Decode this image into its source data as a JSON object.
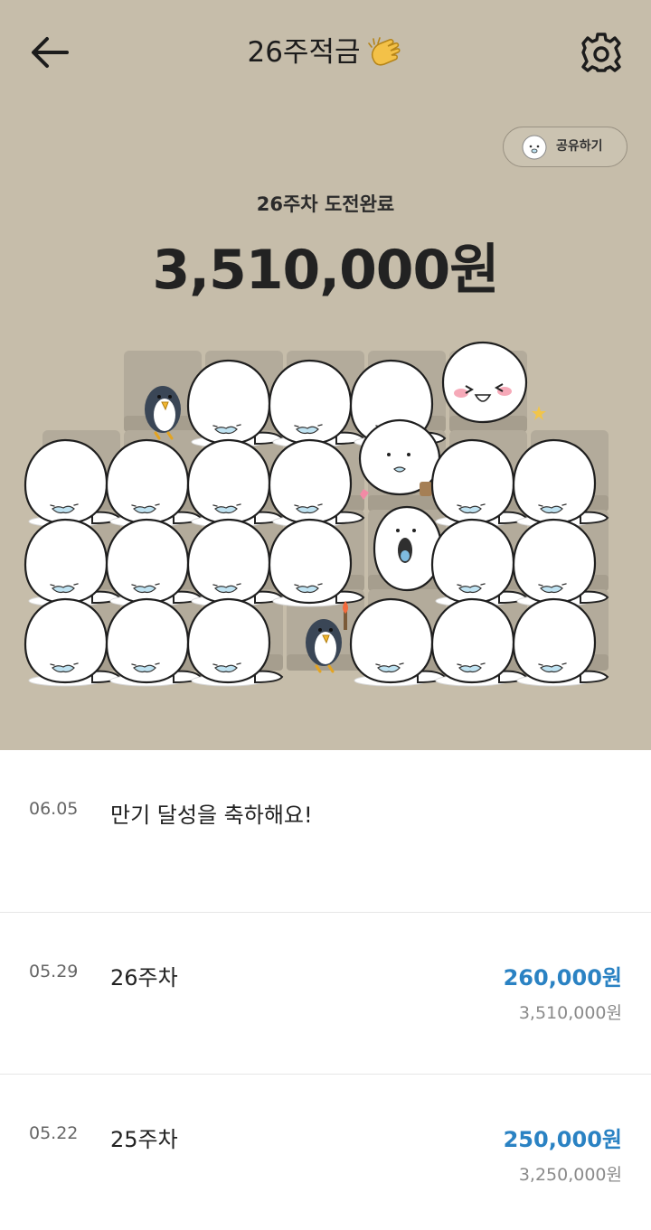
{
  "header": {
    "title": "26주적금",
    "back_icon": "arrow-left-icon",
    "title_icon": "clapping-hands-icon",
    "settings_icon": "gear-icon"
  },
  "share": {
    "label": "공유하기",
    "icon": "seal-face-icon"
  },
  "summary": {
    "label": "26주차 도전완료",
    "amount": "3,510,000원"
  },
  "grid": {
    "weeks_total": 26,
    "weeks_completed": 26,
    "tile_color": "#b3ab9b",
    "seal_color": "#ffffff",
    "penguin_color": "#3a4656"
  },
  "history": [
    {
      "date": "06.05",
      "desc": "만기 달성을 축하해요!",
      "amount": "",
      "total": ""
    },
    {
      "date": "05.29",
      "desc": "26주차",
      "amount": "260,000원",
      "total": "3,510,000원"
    },
    {
      "date": "05.22",
      "desc": "25주차",
      "amount": "250,000원",
      "total": "3,250,000원"
    }
  ],
  "colors": {
    "hero_bg": "#c6bdaa",
    "amount_blue": "#2a82c3"
  }
}
